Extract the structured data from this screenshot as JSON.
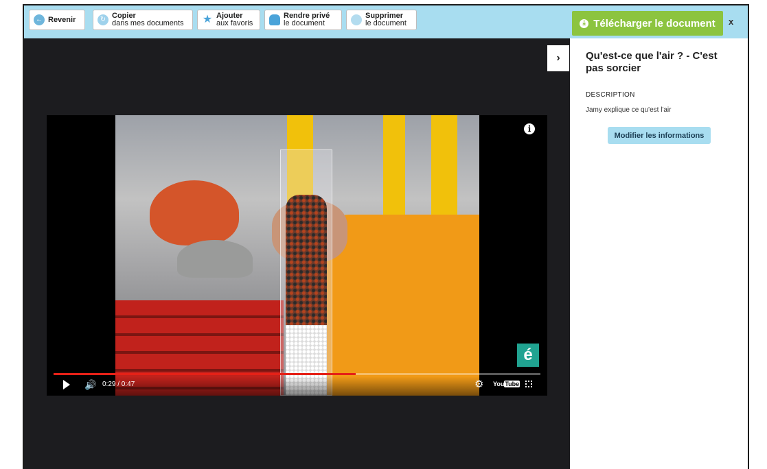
{
  "toolbar": {
    "back": {
      "label": "Revenir",
      "icon": "arrow-left-icon",
      "color": "#6fb6dc"
    },
    "copy": {
      "line1": "Copier",
      "line2": "dans mes documents",
      "icon": "copy-icon",
      "color": "#9fd2ec"
    },
    "favorite": {
      "line1": "Ajouter",
      "line2": "aux favoris",
      "icon": "star-icon",
      "color": "#4aa3d9"
    },
    "private": {
      "line1": "Rendre privé",
      "line2": "le document",
      "icon": "lock-icon",
      "color": "#4aa3d9"
    },
    "delete": {
      "line1": "Supprimer",
      "line2": "le document",
      "icon": "trash-icon",
      "color": "#b3dcef"
    }
  },
  "download": {
    "label": "Télécharger le document",
    "icon": "download-icon",
    "color": "#8cc43f"
  },
  "close_label": "x",
  "player": {
    "current_time": "0:29",
    "duration": "0:47",
    "time_display": "0:29 / 0:47",
    "progress": 0.62,
    "channel_logo": "é",
    "youtube_you": "You",
    "youtube_tube": "Tube",
    "progress_color": "#e52117"
  },
  "sidebar": {
    "title": "Qu'est-ce que l'air ? - C'est pas sorcier",
    "description_heading": "DESCRIPTION",
    "description": "Jamy explique ce qu'est l'air",
    "edit_button": "Modifier les informations"
  }
}
